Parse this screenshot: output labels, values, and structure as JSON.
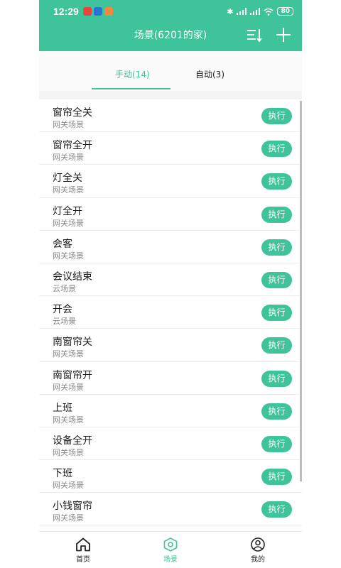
{
  "status_bar": {
    "time": "12:29",
    "battery": "80",
    "app_icon_colors": [
      "#e8453c",
      "#2a73d9",
      "#f08a3c"
    ]
  },
  "header": {
    "title": "场景(6201的家)",
    "sort_icon": "sort-icon",
    "add_icon": "plus-icon"
  },
  "tabs": [
    {
      "label": "手动(14)",
      "active": true
    },
    {
      "label": "自动(3)",
      "active": false
    }
  ],
  "scenes": [
    {
      "name": "窗帘全关",
      "type": "网关场景",
      "action": "执行"
    },
    {
      "name": "窗帘全开",
      "type": "网关场景",
      "action": "执行"
    },
    {
      "name": "灯全关",
      "type": "网关场景",
      "action": "执行"
    },
    {
      "name": "灯全开",
      "type": "网关场景",
      "action": "执行"
    },
    {
      "name": "会客",
      "type": "网关场景",
      "action": "执行"
    },
    {
      "name": "会议结束",
      "type": "云场景",
      "action": "执行"
    },
    {
      "name": "开会",
      "type": "云场景",
      "action": "执行"
    },
    {
      "name": "南窗帘关",
      "type": "网关场景",
      "action": "执行"
    },
    {
      "name": "南窗帘开",
      "type": "网关场景",
      "action": "执行"
    },
    {
      "name": "上班",
      "type": "网关场景",
      "action": "执行"
    },
    {
      "name": "设备全开",
      "type": "网关场景",
      "action": "执行"
    },
    {
      "name": "下班",
      "type": "网关场景",
      "action": "执行"
    },
    {
      "name": "小钱窗帘",
      "type": "网关场景",
      "action": "执行"
    }
  ],
  "bottom_nav": [
    {
      "label": "首页",
      "icon": "home-icon",
      "active": false
    },
    {
      "label": "场景",
      "icon": "scene-hexagon-icon",
      "active": true
    },
    {
      "label": "我的",
      "icon": "user-icon",
      "active": false
    }
  ],
  "colors": {
    "accent": "#3fc39b"
  }
}
